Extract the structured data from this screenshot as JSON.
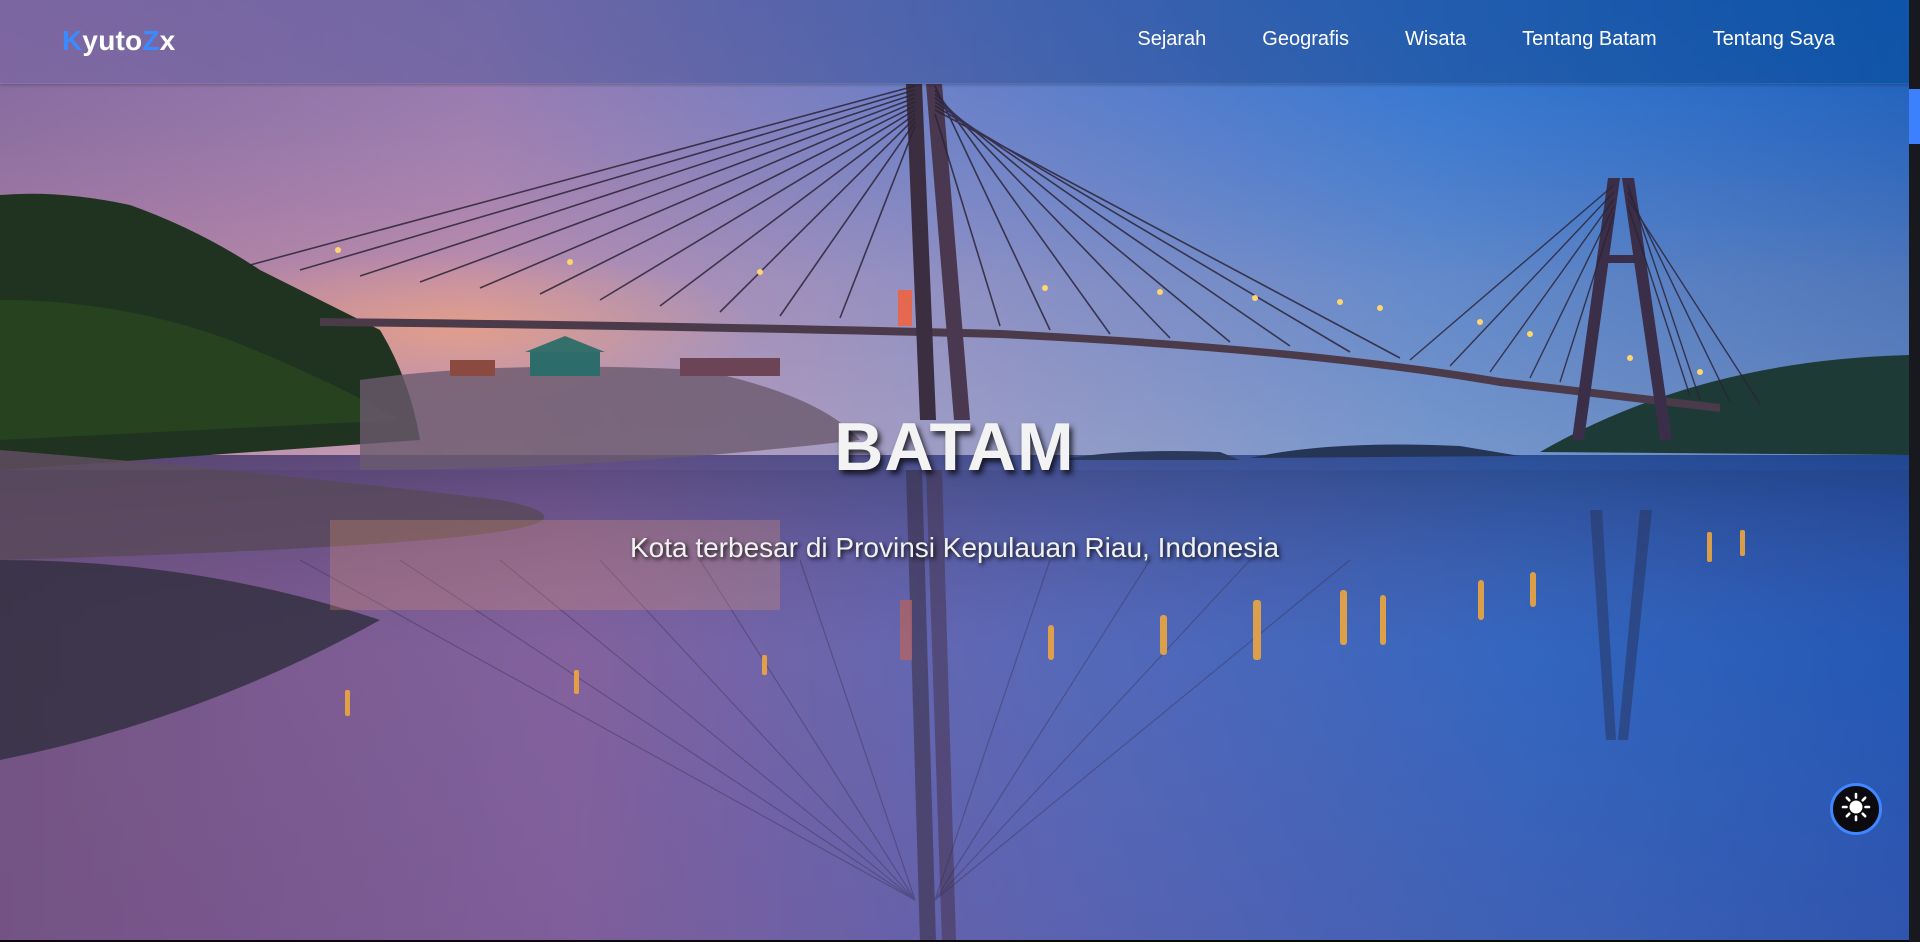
{
  "brand": {
    "logo_first": "K",
    "logo_mid1": "yuto",
    "logo_mid2": "Z",
    "logo_last": "x"
  },
  "nav": {
    "items": [
      {
        "label": "Sejarah"
      },
      {
        "label": "Geografis"
      },
      {
        "label": "Wisata"
      },
      {
        "label": "Tentang Batam"
      },
      {
        "label": "Tentang Saya"
      }
    ]
  },
  "hero": {
    "title": "BATAM",
    "subtitle": "Kota terbesar di Provinsi Kepulauan Riau, Indonesia"
  },
  "theme_toggle": {
    "icon": "sun-icon"
  },
  "colors": {
    "accent": "#3a8bff",
    "toggle_border": "#3f86ff",
    "scroll_thumb": "#3c80ff"
  }
}
